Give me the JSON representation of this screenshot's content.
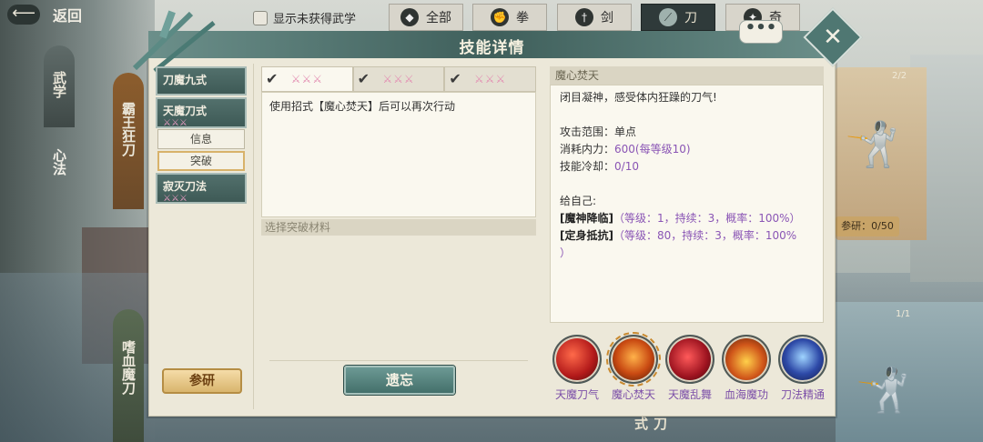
{
  "topbar": {
    "back_label": "返回",
    "filter_label": "显示未获得武学",
    "tabs": [
      {
        "icon": "bag-icon",
        "label": "全部"
      },
      {
        "icon": "fist-icon",
        "label": "拳"
      },
      {
        "icon": "sword-icon",
        "label": "剑"
      },
      {
        "icon": "blade-icon",
        "label": "刀"
      },
      {
        "icon": "odd-weapon-icon",
        "label": "奇"
      }
    ],
    "active_tab": "刀"
  },
  "left_nav": {
    "tabs": [
      "武学",
      "心法"
    ],
    "cards": [
      "霸王狂刀",
      "嗜血魔刀"
    ]
  },
  "background": {
    "card1_count": "2/2",
    "card1_research": "参研：0/50",
    "card2_count": "1/1",
    "card2_label": "刀式"
  },
  "modal": {
    "title": "技能详情",
    "skills": [
      {
        "name": "刀魔九式",
        "marks": ""
      },
      {
        "name": "天魔刀式",
        "marks": "⚔⚔⚔"
      },
      {
        "name": "寂灭刀法",
        "marks": "⚔⚔⚔"
      }
    ],
    "sub_tabs": [
      "信息",
      "突破"
    ],
    "active_sub_tab": "突破",
    "research_button": "参研",
    "break_tabs": [
      {
        "checked": true,
        "marks": "⚔⚔⚔"
      },
      {
        "checked": true,
        "marks": "⚔⚔⚔"
      },
      {
        "checked": true,
        "marks": "⚔⚔⚔"
      }
    ],
    "break_description": "使用招式【魔心焚天】后可以再次行动",
    "materials_header": "选择突破材料",
    "forget_button": "遗忘",
    "detail": {
      "title": "魔心焚天",
      "flavor": "闭目凝神，感受体内狂躁的刀气!",
      "range_label": "攻击范围：",
      "range_value": "单点",
      "cost_label": "消耗内力：",
      "cost_value": "600(每等级10)",
      "cooldown_label": "技能冷却：",
      "cooldown_value": "0/10",
      "self_label": "给自己:",
      "effect1_name": "[魔神降临]",
      "effect1_detail": "（等级：1，持续：3，概率：100%）",
      "effect2_name": "[定身抵抗]",
      "effect2_detail": "（等级：80，持续：3，概率：100%",
      "effect2_tail": "）"
    },
    "skill_icons": [
      {
        "name": "天魔刀气",
        "icon": "blade-qi-icon",
        "color": "#b31a1a"
      },
      {
        "name": "魔心焚天",
        "icon": "demon-heart-icon",
        "color": "#c94a12"
      },
      {
        "name": "天魔乱舞",
        "icon": "chaos-dance-icon",
        "color": "#9e1420"
      },
      {
        "name": "血海魔功",
        "icon": "blood-sea-icon",
        "color": "#d0561a"
      },
      {
        "name": "刀法精通",
        "icon": "mastery-icon",
        "color": "#2e4aa8"
      }
    ],
    "selected_icon": "魔心焚天"
  }
}
